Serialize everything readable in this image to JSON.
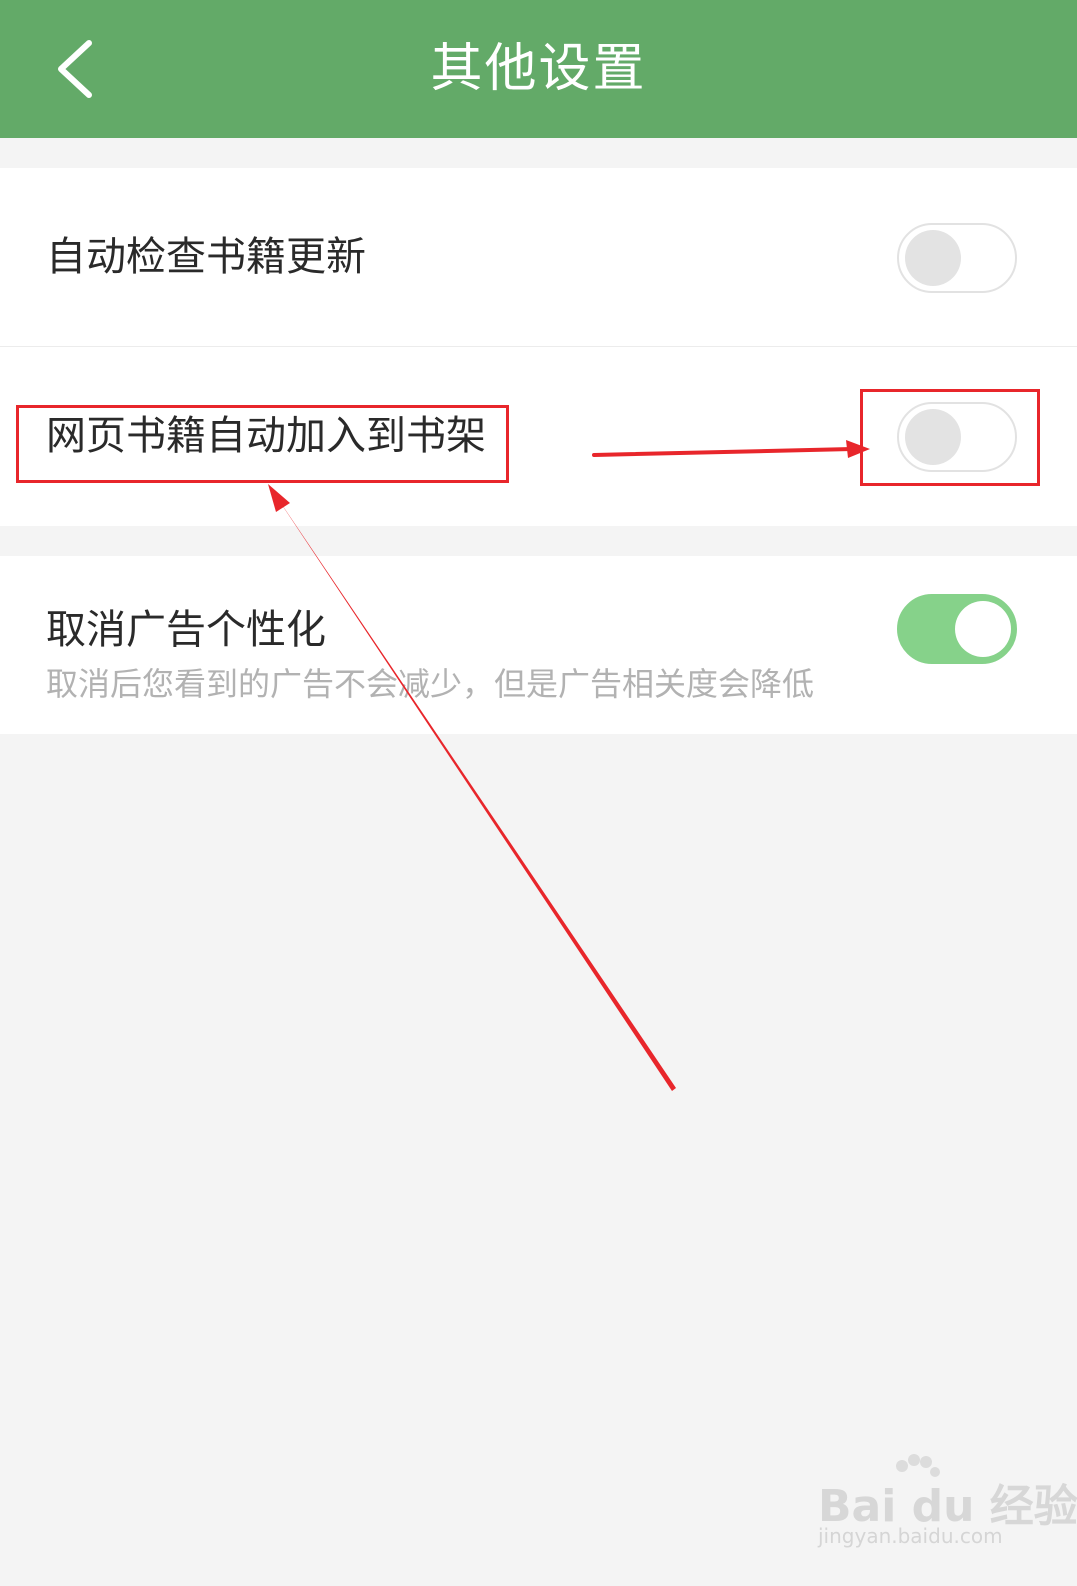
{
  "header": {
    "title": "其他设置",
    "back_icon": "chevron-left-icon"
  },
  "settings": [
    {
      "label": "自动检查书籍更新",
      "enabled": false
    },
    {
      "label": "网页书籍自动加入到书架",
      "enabled": false
    },
    {
      "label": "取消广告个性化",
      "description": "取消后您看到的广告不会减少，但是广告相关度会降低",
      "enabled": true
    }
  ],
  "colors": {
    "header": "#63aa68",
    "switch_on": "#86d28a",
    "annotation": "#e8262b"
  },
  "watermark": {
    "logo_text": "Bai du 经验",
    "url": "jingyan.baidu.com"
  }
}
